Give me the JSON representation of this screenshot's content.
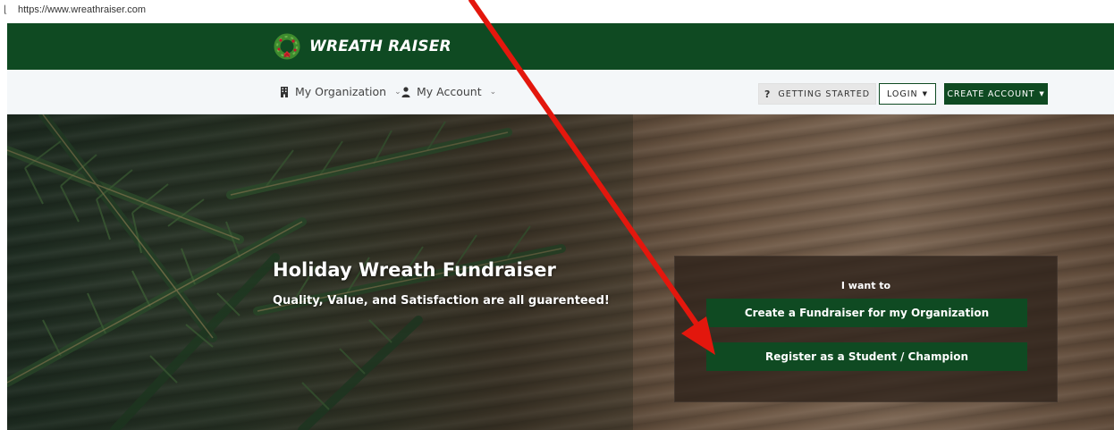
{
  "browser": {
    "url": "https://www.wreathraiser.com"
  },
  "brand": {
    "name": "WREATH RAISER",
    "color": "#0f4a22"
  },
  "nav": {
    "organization_label": "My Organization",
    "account_label": "My Account",
    "getting_started_label": "GETTING STARTED",
    "getting_started_icon": "?",
    "login_label": "LOGIN",
    "create_account_label": "CREATE ACCOUNT"
  },
  "hero": {
    "title": "Holiday Wreath Fundraiser",
    "subtitle": "Quality, Value, and Satisfaction are all guarenteed!",
    "cta_label": "I want to",
    "cta_primary": "Create a Fundraiser for my Organization",
    "cta_secondary": "Register as a Student / Champion"
  },
  "annotation": {
    "arrow_color": "#e3170d"
  }
}
